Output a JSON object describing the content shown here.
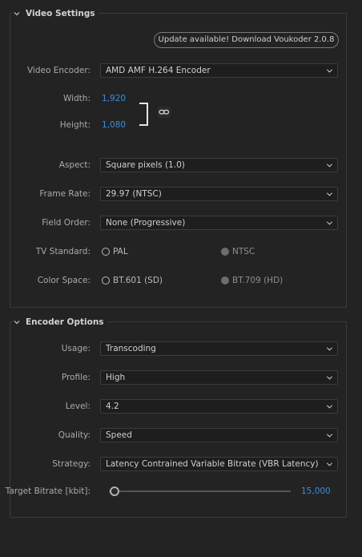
{
  "video_settings": {
    "title": "Video Settings",
    "update_button": "Update available! Download Voukoder 2.0.8",
    "encoder": {
      "label": "Video Encoder:",
      "value": "AMD AMF H.264 Encoder"
    },
    "width": {
      "label": "Width:",
      "value": "1,920"
    },
    "height": {
      "label": "Height:",
      "value": "1,080"
    },
    "aspect": {
      "label": "Aspect:",
      "value": "Square pixels (1.0)"
    },
    "frame_rate": {
      "label": "Frame Rate:",
      "value": "29.97 (NTSC)"
    },
    "field_order": {
      "label": "Field Order:",
      "value": "None (Progressive)"
    },
    "tv_standard": {
      "label": "TV Standard:",
      "options": [
        "PAL",
        "NTSC"
      ]
    },
    "color_space": {
      "label": "Color Space:",
      "options": [
        "BT.601 (SD)",
        "BT.709 (HD)"
      ]
    }
  },
  "encoder_options": {
    "title": "Encoder Options",
    "usage": {
      "label": "Usage:",
      "value": "Transcoding"
    },
    "profile": {
      "label": "Profile:",
      "value": "High"
    },
    "level": {
      "label": "Level:",
      "value": "4.2"
    },
    "quality": {
      "label": "Quality:",
      "value": "Speed"
    },
    "strategy": {
      "label": "Strategy:",
      "value": "Latency Contrained Variable Bitrate (VBR Latency)"
    },
    "target_bitrate": {
      "label": "Target Bitrate [kbit]:",
      "value": "15,000"
    }
  },
  "colors": {
    "accent": "#3c8ddb",
    "background": "#232323"
  }
}
